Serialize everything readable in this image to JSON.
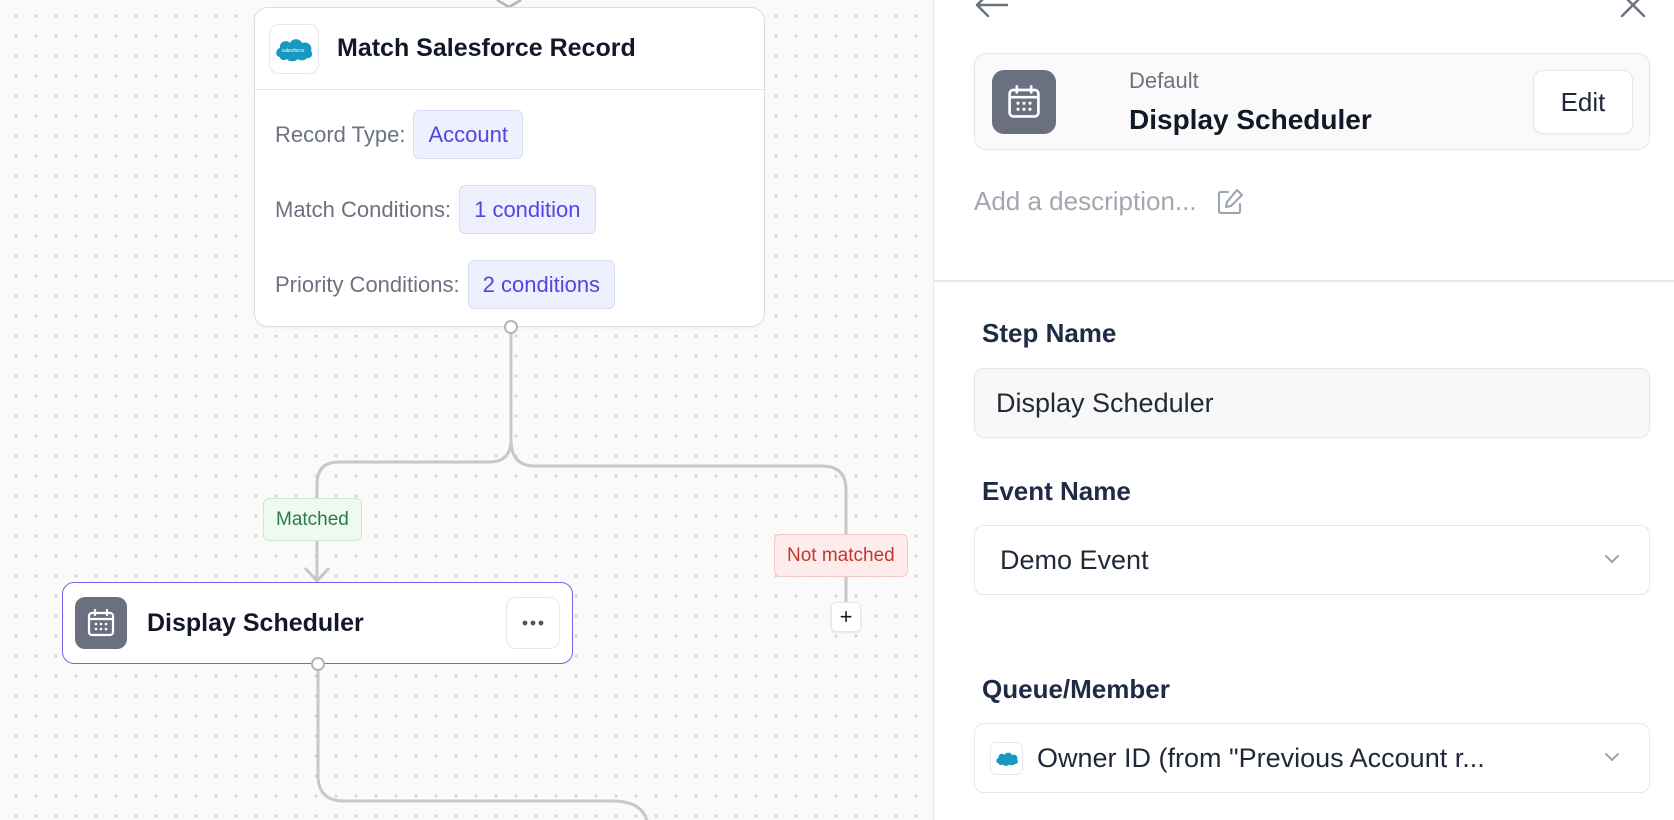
{
  "canvas": {
    "match_node": {
      "title": "Match Salesforce Record",
      "rows": [
        {
          "label": "Record Type:",
          "value": "Account"
        },
        {
          "label": "Match Conditions:",
          "value": "1 condition"
        },
        {
          "label": "Priority Conditions:",
          "value": "2 conditions"
        }
      ]
    },
    "branches": {
      "matched": "Matched",
      "not_matched": "Not matched",
      "add_symbol": "+"
    },
    "step_node": {
      "title": "Display Scheduler"
    }
  },
  "panel": {
    "header": {
      "subtitle": "Default",
      "title": "Display Scheduler",
      "edit_label": "Edit"
    },
    "description_placeholder": "Add a description...",
    "fields": {
      "step_name": {
        "label": "Step Name",
        "value": "Display Scheduler"
      },
      "event_name": {
        "label": "Event Name",
        "value": "Demo Event"
      },
      "queue_member": {
        "label": "Queue/Member",
        "value": "Owner ID (from \"Previous Account r..."
      }
    }
  },
  "icons": {
    "salesforce": "salesforce-logo-icon",
    "calendar": "calendar-icon",
    "more": "more-horizontal-icon",
    "back": "arrow-left-icon",
    "close": "close-icon",
    "edit": "pencil-square-icon",
    "chevron": "chevron-down-icon"
  },
  "colors": {
    "accent": "#4f46e5",
    "selected_border": "#6d68e8",
    "matched": "#2f7a45",
    "not_matched": "#c0392b",
    "salesforce_blue": "#1798c1"
  }
}
